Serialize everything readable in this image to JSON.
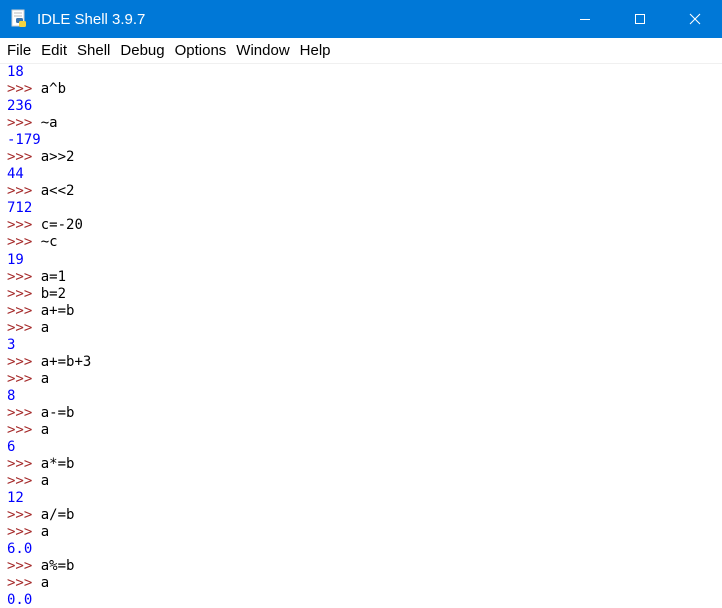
{
  "window": {
    "title": "IDLE Shell 3.9.7",
    "controls": [
      "minimize-icon",
      "maximize-icon",
      "close-icon"
    ]
  },
  "menu": [
    "File",
    "Edit",
    "Shell",
    "Debug",
    "Options",
    "Window",
    "Help"
  ],
  "colors": {
    "titlebar": "#0078d7",
    "prompt": "#a52a2a",
    "output": "#0000ff",
    "input": "#000000"
  },
  "shell": {
    "prompt": ">>>",
    "lines": [
      {
        "type": "output",
        "text": "18"
      },
      {
        "type": "input",
        "text": "a^b"
      },
      {
        "type": "output",
        "text": "236"
      },
      {
        "type": "input",
        "text": "~a"
      },
      {
        "type": "output",
        "text": "-179"
      },
      {
        "type": "input",
        "text": "a>>2"
      },
      {
        "type": "output",
        "text": "44"
      },
      {
        "type": "input",
        "text": "a<<2"
      },
      {
        "type": "output",
        "text": "712"
      },
      {
        "type": "input",
        "text": "c=-20"
      },
      {
        "type": "input",
        "text": "~c"
      },
      {
        "type": "output",
        "text": "19"
      },
      {
        "type": "input",
        "text": "a=1"
      },
      {
        "type": "input",
        "text": "b=2"
      },
      {
        "type": "input",
        "text": "a+=b"
      },
      {
        "type": "input",
        "text": "a"
      },
      {
        "type": "output",
        "text": "3"
      },
      {
        "type": "input",
        "text": "a+=b+3"
      },
      {
        "type": "input",
        "text": "a"
      },
      {
        "type": "output",
        "text": "8"
      },
      {
        "type": "input",
        "text": "a-=b"
      },
      {
        "type": "input",
        "text": "a"
      },
      {
        "type": "output",
        "text": "6"
      },
      {
        "type": "input",
        "text": "a*=b"
      },
      {
        "type": "input",
        "text": "a"
      },
      {
        "type": "output",
        "text": "12"
      },
      {
        "type": "input",
        "text": "a/=b"
      },
      {
        "type": "input",
        "text": "a"
      },
      {
        "type": "output",
        "text": "6.0"
      },
      {
        "type": "input",
        "text": "a%=b"
      },
      {
        "type": "input",
        "text": "a"
      },
      {
        "type": "output",
        "text": "0.0"
      }
    ]
  }
}
